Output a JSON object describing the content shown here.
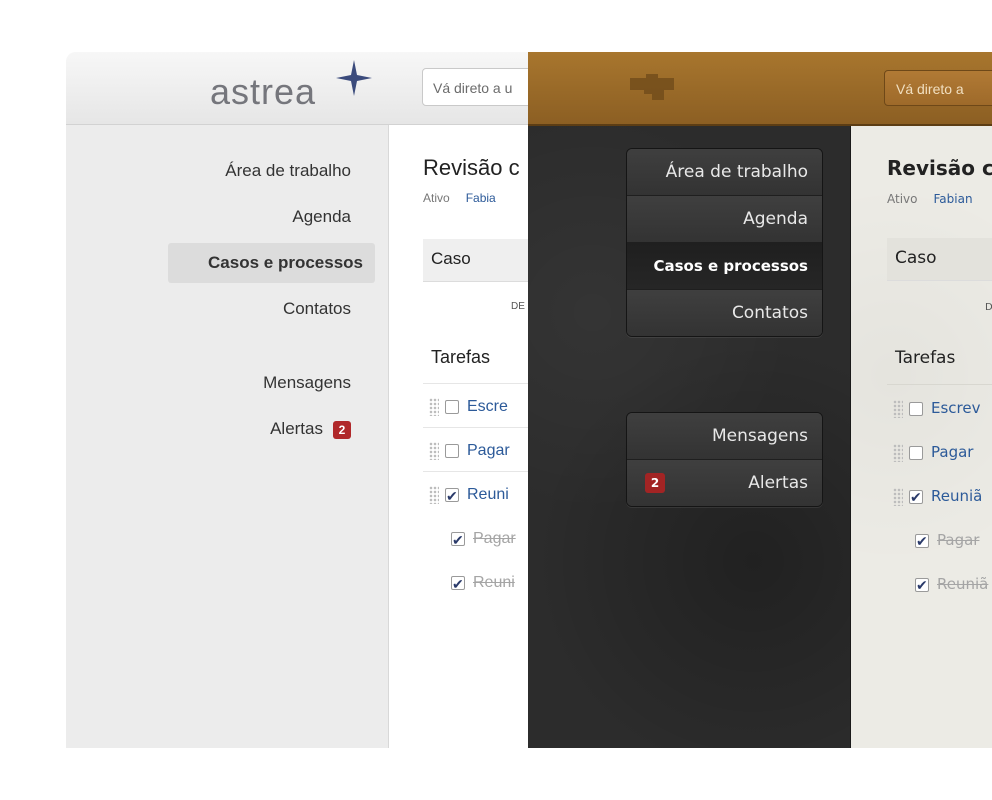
{
  "light": {
    "logo_text": "astrea",
    "search_placeholder": "Vá direto a u",
    "sidebar": [
      {
        "label": "Área de trabalho"
      },
      {
        "label": "Agenda"
      },
      {
        "label": "Casos e processos",
        "active": true
      },
      {
        "label": "Contatos"
      },
      {
        "label": "Mensagens"
      },
      {
        "label": "Alertas",
        "badge": "2"
      }
    ],
    "main": {
      "title": "Revisão c",
      "status": "Ativo",
      "owner": "Fabia",
      "case_label": "Caso",
      "de_label": "DE",
      "tasks_heading": "Tarefas",
      "tasks": [
        {
          "text": "Escre",
          "checked": false,
          "done": false
        },
        {
          "text": "Pagar",
          "checked": false,
          "done": false
        },
        {
          "text": "Reuni",
          "checked": true,
          "done": false
        },
        {
          "text": "Pagar",
          "checked": true,
          "done": true
        },
        {
          "text": "Reuni",
          "checked": true,
          "done": true
        }
      ]
    }
  },
  "dark": {
    "search_placeholder": "Vá direto a",
    "sidebar": [
      {
        "label": "Área de trabalho"
      },
      {
        "label": "Agenda"
      },
      {
        "label": "Casos e processos",
        "active": true
      },
      {
        "label": "Contatos"
      },
      {
        "label": "Mensagens"
      },
      {
        "label": "Alertas",
        "badge": "2"
      }
    ],
    "main": {
      "title": "Revisão co",
      "status": "Ativo",
      "owner": "Fabian",
      "case_label": "Caso",
      "de_label": "D",
      "tasks_heading": "Tarefas",
      "tasks": [
        {
          "text": "Escrev",
          "checked": false,
          "done": false
        },
        {
          "text": "Pagar",
          "checked": false,
          "done": false
        },
        {
          "text": "Reuniã",
          "checked": true,
          "done": false
        },
        {
          "text": "Pagar",
          "checked": true,
          "done": true
        },
        {
          "text": "Reuniã",
          "checked": true,
          "done": true
        }
      ]
    }
  },
  "colors": {
    "accent_blue": "#2c5a99",
    "badge_red": "#b0282a",
    "leather_brown": "#9a6a28",
    "dark_leather": "#2c2c2c"
  }
}
